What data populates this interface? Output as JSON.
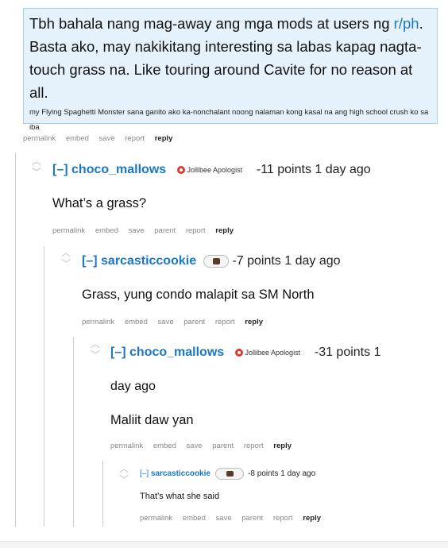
{
  "post": {
    "text_pre": "Tbh bahala nang mag-away ang mga mods at users ng ",
    "subreddit_link": "r/ph",
    "text_post": ". Basta ako, may nakikitang interesting sa labas kapag nagta-touch grass na. Like touring around Cavite for no reason at all.",
    "small_text": "my Flying Spaghetti Monster sana ganito ako ka-nonchalant noong nalaman kong kasal na ang high school crush ko sa iba",
    "links": {
      "permalink": "permalink",
      "embed": "embed",
      "save": "save",
      "report": "report",
      "reply": "reply"
    }
  },
  "comments": [
    {
      "toggle": "[–]",
      "author": "choco_mallows",
      "flair": "Jollibee Apologist",
      "score": "-11 points",
      "time": "1 day ago",
      "body": "What’s a grass?",
      "links": {
        "permalink": "permalink",
        "embed": "embed",
        "save": "save",
        "parent": "parent",
        "report": "report",
        "reply": "reply"
      }
    },
    {
      "toggle": "[–]",
      "author": "sarcasticcookie",
      "score": "-7 points",
      "time": "1 day ago",
      "body": "Grass, yung condo malapit sa SM North",
      "links": {
        "permalink": "permalink",
        "embed": "embed",
        "save": "save",
        "parent": "parent",
        "report": "report",
        "reply": "reply"
      }
    },
    {
      "toggle": "[–]",
      "author": "choco_mallows",
      "flair": "Jollibee Apologist",
      "score": "-31 points 1",
      "time": "day ago",
      "body": "Maliit daw yan",
      "links": {
        "permalink": "permalink",
        "embed": "embed",
        "save": "save",
        "parent": "parent",
        "report": "report",
        "reply": "reply"
      }
    },
    {
      "toggle": "[–]",
      "author": "sarcasticcookie",
      "score": "-8 points",
      "time": "1 day ago",
      "body": "That’s what she said",
      "links": {
        "permalink": "permalink",
        "embed": "embed",
        "save": "save",
        "parent": "parent",
        "report": "report",
        "reply": "reply"
      }
    }
  ],
  "icons": {
    "upvote": "upvote-icon",
    "downvote": "downvote-icon",
    "flair": "jollibee-icon",
    "user_flair": "cookie-icon"
  },
  "colors": {
    "link": "#1a77c4",
    "quote_bg": "#e6f2fb",
    "quote_border": "#a9cfe9"
  }
}
